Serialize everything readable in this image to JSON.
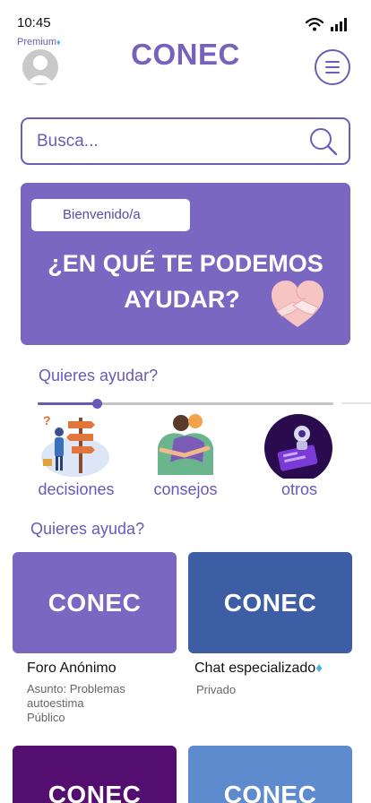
{
  "status": {
    "time": "10:45"
  },
  "header": {
    "premium_label": "Premium",
    "brand": "CONEC"
  },
  "search": {
    "placeholder": "Busca..."
  },
  "banner": {
    "welcome": "Bienvenido/a",
    "title_line1": "¿EN QUÉ TE PODEMOS",
    "title_line2": "AYUDAR?"
  },
  "help_others": {
    "title": "Quieres ayudar?",
    "slider_progress": 0.2,
    "categories": [
      {
        "label": "decisiones",
        "icon": "decision-signpost-icon"
      },
      {
        "label": "consejos",
        "icon": "hug-icon"
      },
      {
        "label": "otros",
        "icon": "robot-phone-icon"
      }
    ]
  },
  "need_help": {
    "title": "Quieres ayuda?",
    "cards": [
      {
        "tile_text": "CONEC",
        "color": "#7a67c2",
        "title": "Foro Anónimo",
        "premium": false,
        "lines": [
          "Asunto: Problemas",
          "autoestima",
          "Público"
        ]
      },
      {
        "tile_text": "CONEC",
        "color": "#3d5ea4",
        "title": "Chat especializado",
        "premium": true,
        "lines": [
          "Privado"
        ]
      },
      {
        "tile_text": "CONEC",
        "color": "#540e70",
        "title": "",
        "premium": false,
        "lines": []
      },
      {
        "tile_text": "CONEC",
        "color": "#5d8bce",
        "title": "",
        "premium": false,
        "lines": []
      }
    ]
  },
  "colors": {
    "accent": "#6f5bb8",
    "banner": "#7a67c2",
    "gem": "#4ab0ea"
  }
}
